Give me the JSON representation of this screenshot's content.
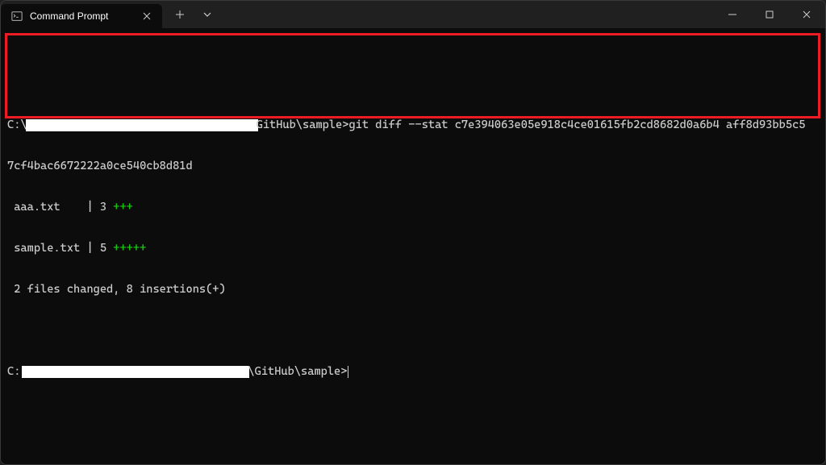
{
  "titlebar": {
    "tab_title": "Command Prompt"
  },
  "terminal": {
    "prompt1_prefix": "C:\\",
    "prompt1_suffix": "GitHub\\sample>",
    "command_part1": "git diff --stat c7e394063e05e918c4ce01615fb2cd8682d0a6b4 aff8d93bb5c5",
    "command_part2": "7cf4bac6672222a0ce540cb8d81d",
    "diff_line1_file": " aaa.txt    | 3 ",
    "diff_line1_plus": "+++",
    "diff_line2_file": " sample.txt | 5 ",
    "diff_line2_plus": "+++++",
    "summary": " 2 files changed, 8 insertions(+)",
    "prompt2_prefix": "C:",
    "prompt2_suffix": "\\GitHub\\sample>"
  }
}
